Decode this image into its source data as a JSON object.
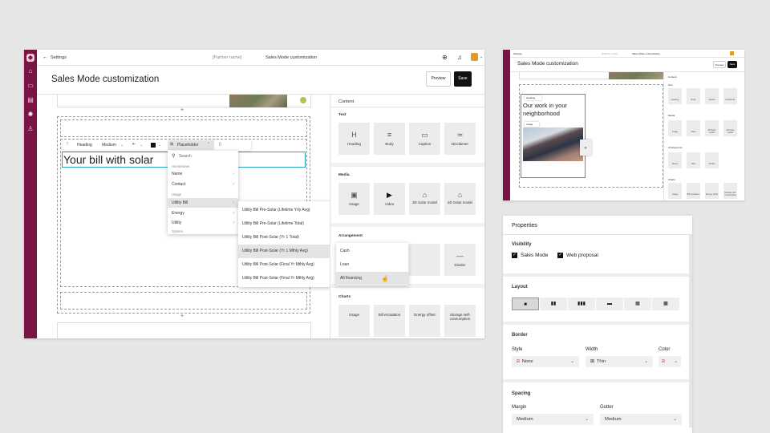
{
  "main": {
    "back_label": "Settings",
    "partner_placeholder": "[Partner name]",
    "breadcrumb_current": "Sales Mode customization",
    "page_title": "Sales Mode customization",
    "preview_label": "Preview",
    "save_label": "Save",
    "toolbar": {
      "type": "Heading",
      "size": "Medium",
      "placeholder": "Placeholder"
    },
    "heading_text": "Your bill with solar",
    "add_symbol": "+",
    "placeholder_menu": {
      "search": "Search",
      "groups": [
        {
          "header": "Homeowner",
          "items": [
            "Name",
            "Contact"
          ]
        },
        {
          "header": "Usage",
          "items": [
            "Utility Bill",
            "Energy",
            "Utility"
          ]
        },
        {
          "header": "System",
          "items": []
        }
      ]
    },
    "submenu_items": [
      "Utility Bill Pre-Solar (Lifetime Yrly Avg)",
      "Utility Bill Pre-Solar (Lifetime Total)",
      "Utility Bill Post-Solar (Yr 1 Total)",
      "Utility Bill Post-Solar (Yr 1 Mthly Avg)",
      "Utility Bill Post-Solar (Final Yr Mthly Avg)",
      "Utility Bill Post-Solar (Final Yr Mthly Avg)"
    ],
    "financing_items": [
      "Cash",
      "Loan",
      "All financing"
    ],
    "content_panel": {
      "title": "Content",
      "sections": {
        "text": "Text",
        "media": "Media",
        "arrangement": "Arrangement",
        "charts": "Charts"
      },
      "text_tiles": [
        "Heading",
        "Body",
        "Caption",
        "Disclaimer"
      ],
      "media_tiles": [
        "Image",
        "Video",
        "3D Solar model",
        "2D Solar model"
      ],
      "arrangement_tiles": [
        "Divider"
      ],
      "chart_tiles": [
        "Usage",
        "Bill escalation",
        "Energy offset",
        "Storage self-consumption"
      ]
    }
  },
  "thumb": {
    "back_label": "Settings",
    "partner_placeholder": "[Partner name]",
    "breadcrumb_current": "Sales Mode customization",
    "page_title": "Sales Mode customization",
    "preview_label": "Preview",
    "save_label": "Save",
    "heading_chip": "Heading",
    "heading_text": "Our work in your neighborhood",
    "image_chip": "Image",
    "panel": {
      "title": "Content",
      "text": "Text",
      "media": "Media",
      "arrangement": "Arrangement",
      "charts": "Charts",
      "text_tiles": [
        "Heading",
        "Body",
        "Caption",
        "Disclaimer"
      ],
      "media_tiles": [
        "Image",
        "Video",
        "3D Solar model",
        "2D Solar model"
      ],
      "arrangement_tiles": [
        "Space",
        "Tabs",
        "Divider"
      ],
      "chart_tiles": [
        "Usage",
        "Bill escalation",
        "Energy offset",
        "Storage self-consumption"
      ]
    }
  },
  "props": {
    "title": "Properties",
    "visibility": {
      "label": "Visibility",
      "options": [
        "Sales Mode",
        "Web proposal"
      ]
    },
    "layout_label": "Layout",
    "border": {
      "label": "Border",
      "style_label": "Style",
      "style_value": "None",
      "width_label": "Width",
      "width_value": "Thin",
      "color_label": "Color"
    },
    "spacing": {
      "label": "Spacing",
      "margin_label": "Margin",
      "margin_value": "Medium",
      "gutter_label": "Gutter",
      "gutter_value": "Medium"
    }
  },
  "colors": {
    "rail": "#7a1445",
    "selection": "#2aa3c2",
    "black": "#111111"
  }
}
